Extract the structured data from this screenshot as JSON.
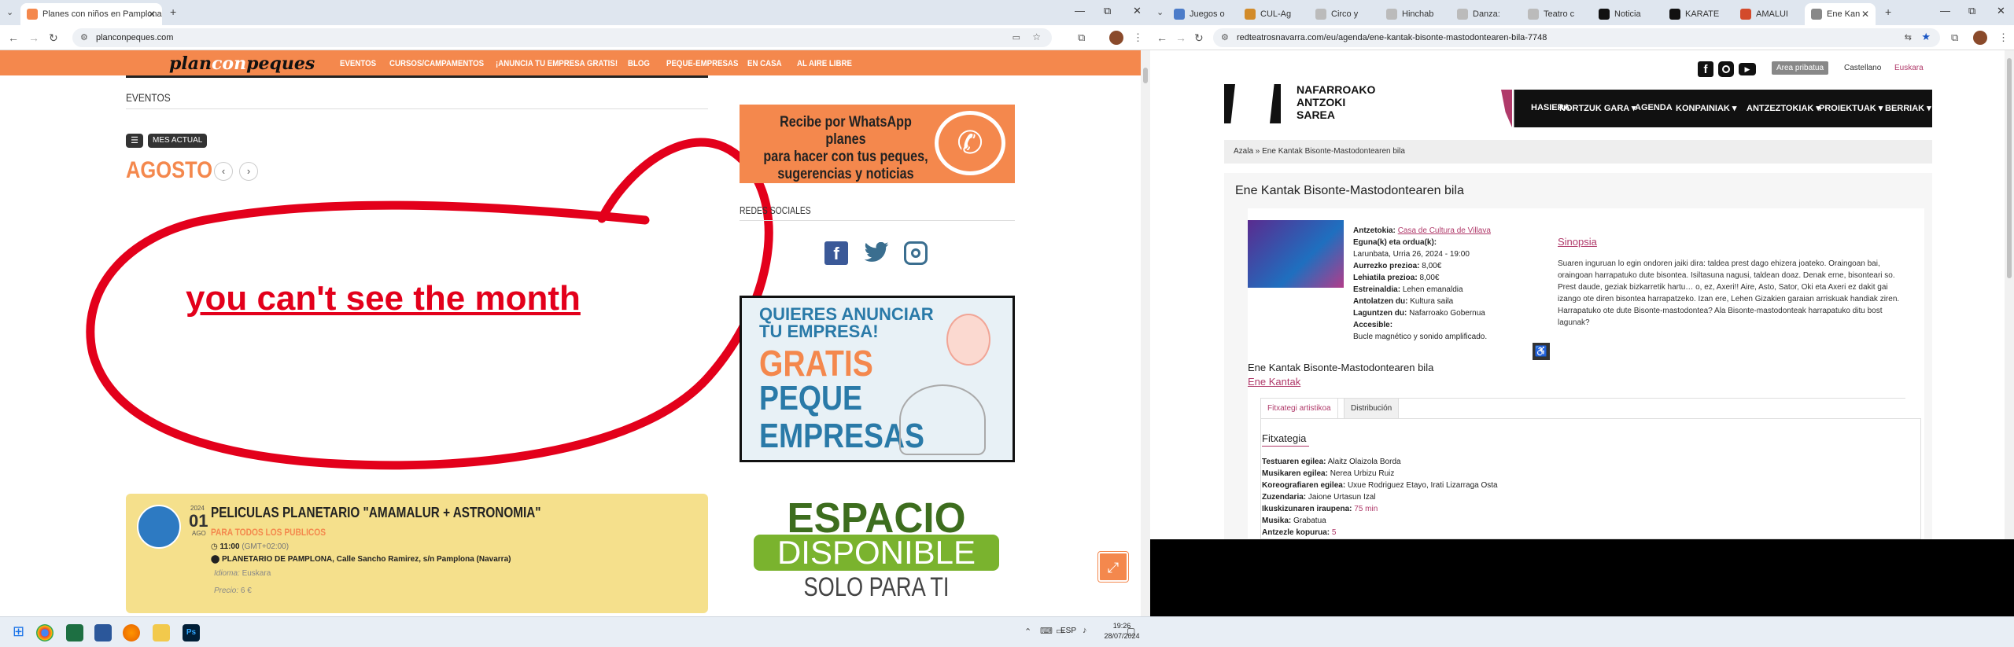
{
  "left_browser": {
    "tabs": [
      {
        "title": "Planes con niños en Pamplona"
      }
    ],
    "new_tab": "+",
    "url": "planconpeques.com",
    "window_controls": {
      "min": "—",
      "max": "⧉",
      "close": "✕"
    }
  },
  "left_site": {
    "logo": "planconpeques",
    "logo_parts": {
      "a": "plan",
      "b": "con",
      "c": "peques"
    },
    "menu": [
      "EVENTOS",
      "CURSOS/CAMPAMENTOS",
      "¡ANUNCIA TU EMPRESA GRATIS!",
      "BLOG",
      "PEQUE-EMPRESAS",
      "EN CASA",
      "AL AIRE LIBRE"
    ],
    "section_title": "EVENTOS",
    "view_label": "MES ACTUAL",
    "month": "AGOSTO",
    "annotation": "you can't see the month",
    "event": {
      "year": "2024",
      "month_short": "AGO",
      "day": "01",
      "title": "PELICULAS PLANETARIO \"AMAMALUR + ASTRONOMIA\"",
      "audience": "PARA TODOS LOS PUBLICOS",
      "time": "11:00",
      "tz": "(GMT+02:00)",
      "location": "PLANETARIO DE PAMPLONA, Calle Sancho Ramirez, s/n Pamplona (Navarra)",
      "language_label": "Idioma:",
      "language": "Euskara",
      "price_label": "Precio:",
      "price": "6 €"
    },
    "whatsapp_ad": {
      "line1": "Recibe por WhatsApp planes",
      "line2": "para hacer con tus peques,",
      "line3": "sugerencias y noticias"
    },
    "social_title": "REDES SOCIALES",
    "promo": {
      "line1": "QUIERES ANUNCIAR",
      "line2": "TU EMPRESA!",
      "line3": "GRATIS",
      "line4": "PEQUE",
      "line5": "EMPRESAS"
    },
    "space_ad": {
      "line1": "ESPACIO",
      "line2": "DISPONIBLE",
      "line3": "SOLO PARA TI"
    }
  },
  "right_browser": {
    "tabs": [
      "Juegos o",
      "CUL-Ag",
      "Circo y",
      "Hinchab",
      "Danza:",
      "Teatro c",
      "Noticia",
      "KARATE",
      "AMALUI",
      "Ene Kan"
    ],
    "url": "redteatrosnavarra.com/eu/agenda/ene-kantak-bisonte-mastodontearen-bila-7748"
  },
  "right_site": {
    "org_name": [
      "NAFARROAKO",
      "ANTZOKI",
      "SAREA"
    ],
    "private_area": "Area pribatua",
    "lang_es": "Castellano",
    "lang_eu": "Euskara",
    "menu": [
      "HASIERA",
      "NORTZUK GARA ▾",
      "AGENDA",
      "KONPAINIAK ▾",
      "ANTZEZTOKIAK ▾",
      "PROIEKTUAK ▾",
      "BERRIAK ▾"
    ],
    "breadcrumb": "Azala » Ene Kantak Bisonte-Mastodontearen bila",
    "title": "Ene Kantak Bisonte-Mastodontearen bila",
    "info": [
      {
        "label": "Antzetokia:",
        "value": "Casa de Cultura de Villava",
        "link": true
      },
      {
        "label": "Eguna(k) eta ordua(k):",
        "value": "",
        "link": false
      },
      {
        "label": "",
        "value": "Larunbata, Urria 26, 2024 - 19:00",
        "link": false
      },
      {
        "label": "Aurrezko prezioa:",
        "value": "8,00€",
        "link": false
      },
      {
        "label": "Lehiatila prezioa:",
        "value": "8,00€",
        "link": false
      },
      {
        "label": "Estreinaldia:",
        "value": "Lehen emanaldia",
        "link": false
      },
      {
        "label": "Antolatzen du:",
        "value": "Kultura saila",
        "link": false
      },
      {
        "label": "Laguntzen du:",
        "value": "Nafarroako Gobernua",
        "link": false
      },
      {
        "label": "Accesible:",
        "value": "",
        "link": false
      },
      {
        "label": "",
        "value": "Bucle magnético y sonido amplificado.",
        "link": false
      }
    ],
    "sinopsia_title": "Sinopsia",
    "sinopsia": "Suaren inguruan lo egin ondoren jaiki dira: taldea prest dago ehizera joateko. Oraingoan bai, oraingoan harrapatuko dute bisontea. Isiltasuna nagusi, taldean doaz. Denak erne, bisonteari so. Prest daude, geziak bizkarretik hartu… o, ez, Axeri!! Aire, Asto, Sator, Oki eta Axeri ez dakit gai izango ote diren bisontea harrapatzeko. Izan ere, Lehen Gizakien garaian arriskuak handiak ziren. Harrapatuko ote dute Bisonte-mastodontea? Ala Bisonte-mastodonteak harrapatuko ditu bost lagunak?",
    "subtitle": "Ene Kantak Bisonte-Mastodontearen bila",
    "company": "Ene Kantak",
    "tabs": [
      "Fitxategi artistikoa",
      "Distribución"
    ],
    "fitxa_title": "Fitxategia",
    "credits": [
      {
        "label": "Testuaren egilea:",
        "value": "Alaitz Olaizola Borda"
      },
      {
        "label": "Musikaren egilea:",
        "value": "Nerea Urbizu Ruiz"
      },
      {
        "label": "Koreografiaren egilea:",
        "value": "Uxue Rodriguez Etayo, Irati Lizarraga Osta"
      },
      {
        "label": "Zuzendaria:",
        "value": "Jaione Urtasun Izal"
      },
      {
        "label": "Ikuskizunaren iraupena:",
        "value": "75 min"
      },
      {
        "label": "Musika:",
        "value": "Grabatua"
      },
      {
        "label": "Antzezle kopurua:",
        "value": "5"
      }
    ]
  },
  "taskbar": {
    "lang": "ESP",
    "time": "19:26",
    "date": "28/07/2024"
  },
  "colors": {
    "orange": "#f4884d",
    "pink": "#b03a6a",
    "red_annotation": "#e3001b",
    "event_bg": "#f5e08c"
  }
}
